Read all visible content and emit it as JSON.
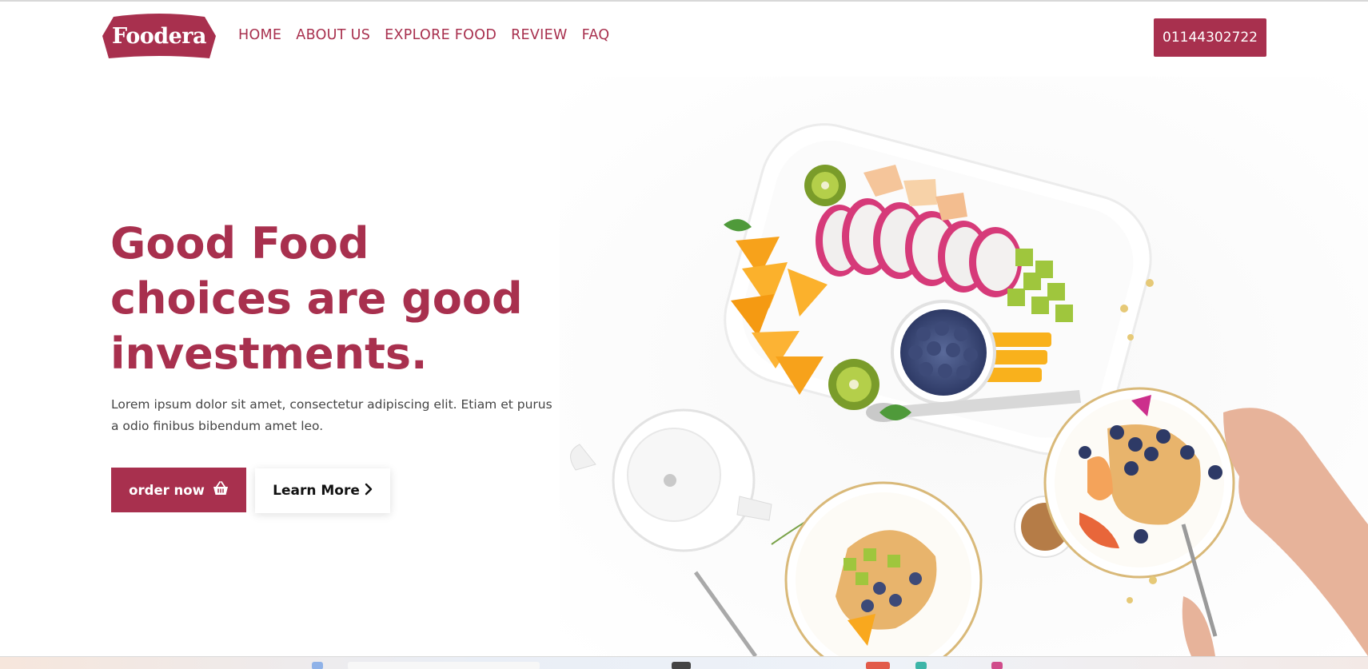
{
  "brand": {
    "name": "Foodera",
    "color": "#a8304e"
  },
  "nav": {
    "items": [
      {
        "label": "HOME"
      },
      {
        "label": "ABOUT US"
      },
      {
        "label": "EXPLORE FOOD"
      },
      {
        "label": "REVIEW"
      },
      {
        "label": "FAQ"
      }
    ],
    "phone": "01144302722"
  },
  "hero": {
    "title_lines": [
      "Good Food",
      "choices are good",
      "investments."
    ],
    "description": "Lorem ipsum dolor sit amet, consectetur adipiscing elit. Etiam et purus a odio finibus bibendum amet leo.",
    "order_label": "order now",
    "order_icon": "basket-icon",
    "learn_label": "Learn More",
    "learn_icon": "chevron-right-icon"
  },
  "image": {
    "description_icon": "food-platter-photo"
  }
}
